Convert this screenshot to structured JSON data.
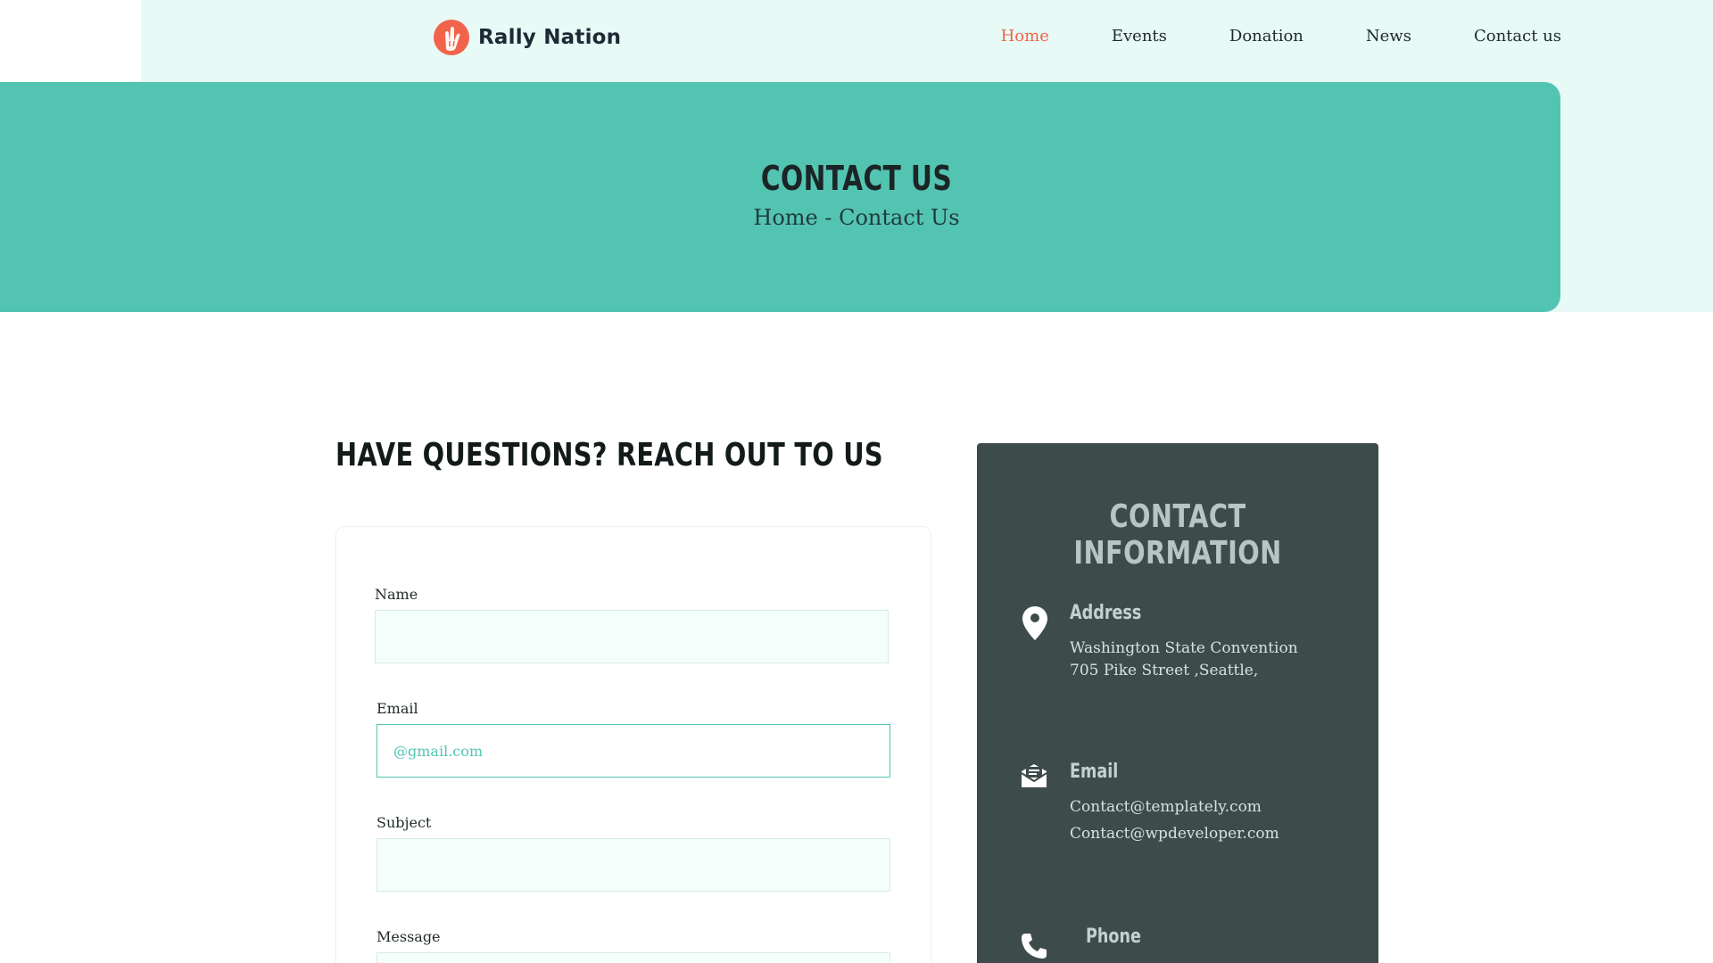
{
  "brand": {
    "name": "Rally Nation"
  },
  "nav": {
    "items": [
      {
        "label": "Home",
        "active": true
      },
      {
        "label": "Events",
        "active": false
      },
      {
        "label": "Donation",
        "active": false
      },
      {
        "label": "News",
        "active": false
      },
      {
        "label": "Contact us",
        "active": false
      }
    ]
  },
  "hero": {
    "title": "CONTACT US",
    "breadcrumb": "Home - Contact Us"
  },
  "form": {
    "heading": "HAVE QUESTIONS? REACH OUT TO US",
    "name_label": "Name",
    "name_value": "",
    "email_label": "Email",
    "email_placeholder": "@gmail.com",
    "subject_label": "Subject",
    "subject_value": "",
    "message_label": "Message"
  },
  "contact_info": {
    "title": "CONTACT INFORMATION",
    "address": {
      "heading": "Address",
      "icon": "map-pin-icon",
      "lines": [
        "Washington State Convention",
        "705 Pike Street ,Seattle,"
      ]
    },
    "email": {
      "heading": "Email",
      "icon": "envelope-icon",
      "lines": [
        "Contact@templately.com",
        "Contact@wpdeveloper.com"
      ]
    },
    "phone": {
      "heading": "Phone",
      "icon": "phone-icon"
    }
  },
  "colors": {
    "accent": "#54c4b2",
    "brand_orange": "#f1634a",
    "light_band": "#e8faf5",
    "info_card": "#3d4c4a"
  }
}
